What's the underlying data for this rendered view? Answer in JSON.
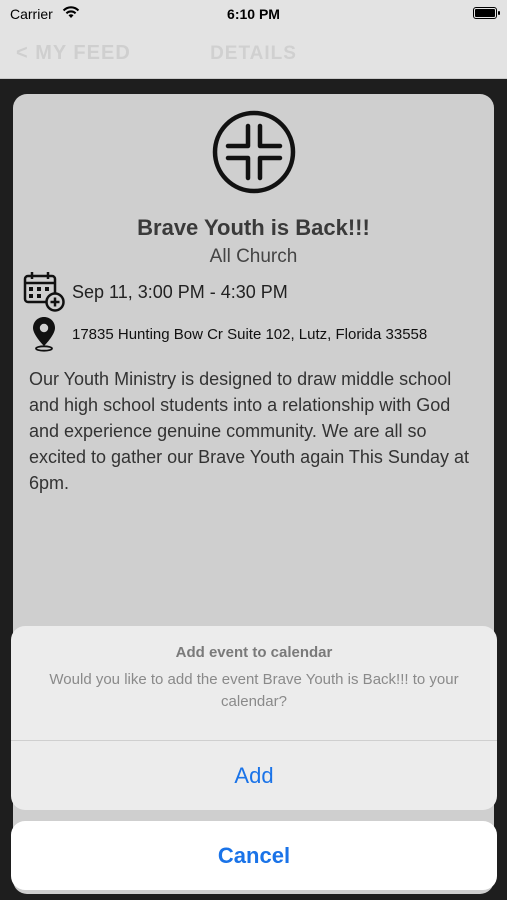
{
  "status_bar": {
    "carrier": "Carrier",
    "time": "6:10 PM"
  },
  "nav": {
    "back_label": "< MY FEED",
    "title": "DETAILS"
  },
  "event": {
    "title": "Brave Youth is Back!!!",
    "subtitle": "All Church",
    "date": "Sep 11, 3:00 PM - 4:30 PM",
    "address": "17835 Hunting Bow Cr Suite 102, Lutz, Florida 33558",
    "description": "Our Youth Ministry is designed to draw middle school and high school students into a relationship with God and experience genuine community. We are all so excited to gather our Brave Youth again This Sunday at 6pm."
  },
  "dialog": {
    "title": "Add event to calendar",
    "message": "Would you like to add the event Brave Youth is Back!!! to your calendar?",
    "add_label": "Add",
    "cancel_label": "Cancel"
  },
  "icons": [
    "wifi-icon",
    "battery-icon",
    "church-cross-logo",
    "calendar-add-icon",
    "location-pin-icon"
  ],
  "colors": {
    "accent": "#1a73e8",
    "dim_overlay": "#1e1e1e",
    "card": "#cfcfcf"
  }
}
